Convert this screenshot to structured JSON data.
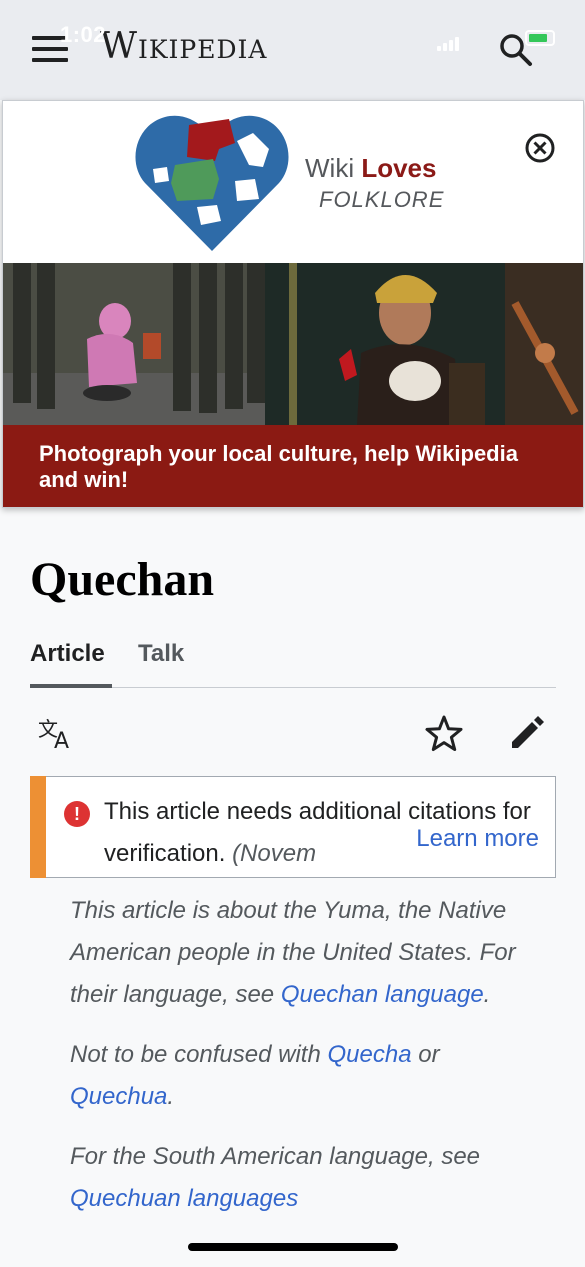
{
  "status_bar": {
    "time": "1:02"
  },
  "header": {
    "wordmark": "Wikipedia",
    "menu_icon": "hamburger-menu-icon",
    "search_icon": "search-icon"
  },
  "banner": {
    "logo_word1": "Wiki",
    "logo_word2": "Loves",
    "logo_line2": "FOLKLORE",
    "cta": "Photograph your local culture, help Wikipedia and win!",
    "colors": {
      "puzzle_blue": "#2e6ba8",
      "puzzle_red": "#a3191c",
      "puzzle_green": "#4f9a5a",
      "cta_bg": "#8b1a13"
    }
  },
  "article": {
    "title": "Quechan",
    "tabs": [
      {
        "label": "Article",
        "active": true
      },
      {
        "label": "Talk",
        "active": false
      }
    ],
    "actions": [
      "language-icon",
      "star-icon",
      "edit-pencil-icon"
    ],
    "notice": {
      "text": "This article needs additional citations for verification.",
      "date": "(Novem",
      "learn_more": "Learn more"
    },
    "hatnotes": [
      {
        "prefix": "This article is about the Yuma, the Native American people in the United States. For their language, see ",
        "links": [
          "Quechan language"
        ],
        "suffix": "."
      },
      {
        "prefix": "Not to be confused with ",
        "links": [
          "Quecha",
          "Quechua"
        ],
        "joiner": " or ",
        "suffix": "."
      },
      {
        "prefix": "For the South American language, see ",
        "links": [
          "Quechuan languages"
        ],
        "suffix": ""
      }
    ]
  }
}
